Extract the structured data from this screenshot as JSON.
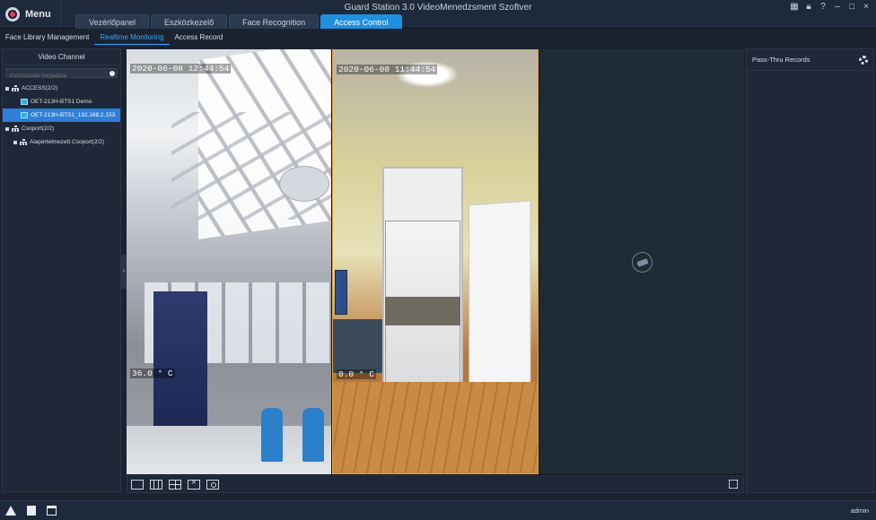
{
  "header": {
    "menu_label": "Menu",
    "app_title": "Guard Station 3.0 VideoMenedzsment Szoftver",
    "tabs": [
      {
        "label": "Vezérlőpanel",
        "active": false
      },
      {
        "label": "Eszközkezelő",
        "active": false
      },
      {
        "label": "Face Recognition",
        "active": false
      },
      {
        "label": "Access Control",
        "active": true
      }
    ],
    "window_controls": [
      "grid-icon",
      "lock-icon",
      "help-icon",
      "minimize-icon",
      "maximize-icon",
      "close-icon"
    ],
    "accent_color": "#1f8fe0"
  },
  "subnav": {
    "tabs": [
      {
        "label": "Face Library Management",
        "active": false
      },
      {
        "label": "Realtime Monitoring",
        "active": true
      },
      {
        "label": "Access Record",
        "active": false
      }
    ]
  },
  "left_panel": {
    "title": "Video Channel",
    "search_placeholder": "Kulcsszavak megadása",
    "tree": [
      {
        "label": "ACCESS(2/2)",
        "level": 0,
        "icon": "org-icon"
      },
      {
        "label": "OET-213H-BTS1 Demo",
        "level": 1,
        "icon": "camera-icon"
      },
      {
        "label": "OET-213H-BTS1_192.168.2.153",
        "level": 1,
        "icon": "camera-icon",
        "selected": true
      },
      {
        "label": "Csoport(2/2)",
        "level": 0,
        "icon": "org-icon"
      },
      {
        "label": "Alapértelmezett Csoport(2/2)",
        "level": 1,
        "icon": "org-icon"
      }
    ]
  },
  "video": {
    "tiles": [
      {
        "timestamp": "2020-06-08 12:44:54",
        "temperature": "36.0 ° C"
      },
      {
        "timestamp": "2020-06-08 11:44:54",
        "temperature": "0.0 ° C"
      }
    ]
  },
  "right_panel": {
    "title": "Pass-Thru Records"
  },
  "statusbar": {
    "user": "admin"
  }
}
